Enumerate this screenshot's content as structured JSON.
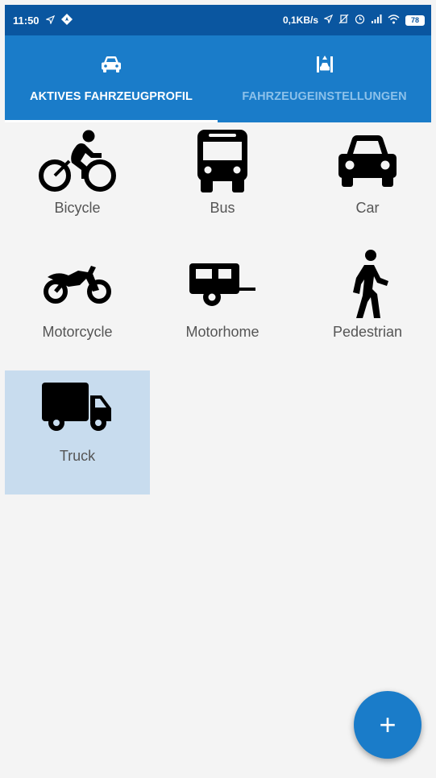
{
  "status_bar": {
    "time": "11:50",
    "network_speed": "0,1KB/s",
    "battery": "78"
  },
  "tabs": [
    {
      "label": "AKTIVES FAHRZEUGPROFIL",
      "icon": "car-icon",
      "active": true
    },
    {
      "label": "FAHRZEUGEINSTELLUNGEN",
      "icon": "vehicle-settings-icon",
      "active": false
    }
  ],
  "vehicles": [
    {
      "label": "Bicycle",
      "icon": "bicycle-icon",
      "selected": false
    },
    {
      "label": "Bus",
      "icon": "bus-icon",
      "selected": false
    },
    {
      "label": "Car",
      "icon": "car-icon",
      "selected": false
    },
    {
      "label": "Motorcycle",
      "icon": "motorcycle-icon",
      "selected": false
    },
    {
      "label": "Motorhome",
      "icon": "motorhome-icon",
      "selected": false
    },
    {
      "label": "Pedestrian",
      "icon": "pedestrian-icon",
      "selected": false
    },
    {
      "label": "Truck",
      "icon": "truck-icon",
      "selected": true
    }
  ],
  "fab": {
    "label": "+",
    "icon": "plus-icon"
  },
  "colors": {
    "status_bar": "#0a56a0",
    "app_bar": "#1a7cc9",
    "inactive_tab_text": "#8cc1ea",
    "selected_tile": "#c8dcee",
    "background": "#f4f4f4"
  }
}
